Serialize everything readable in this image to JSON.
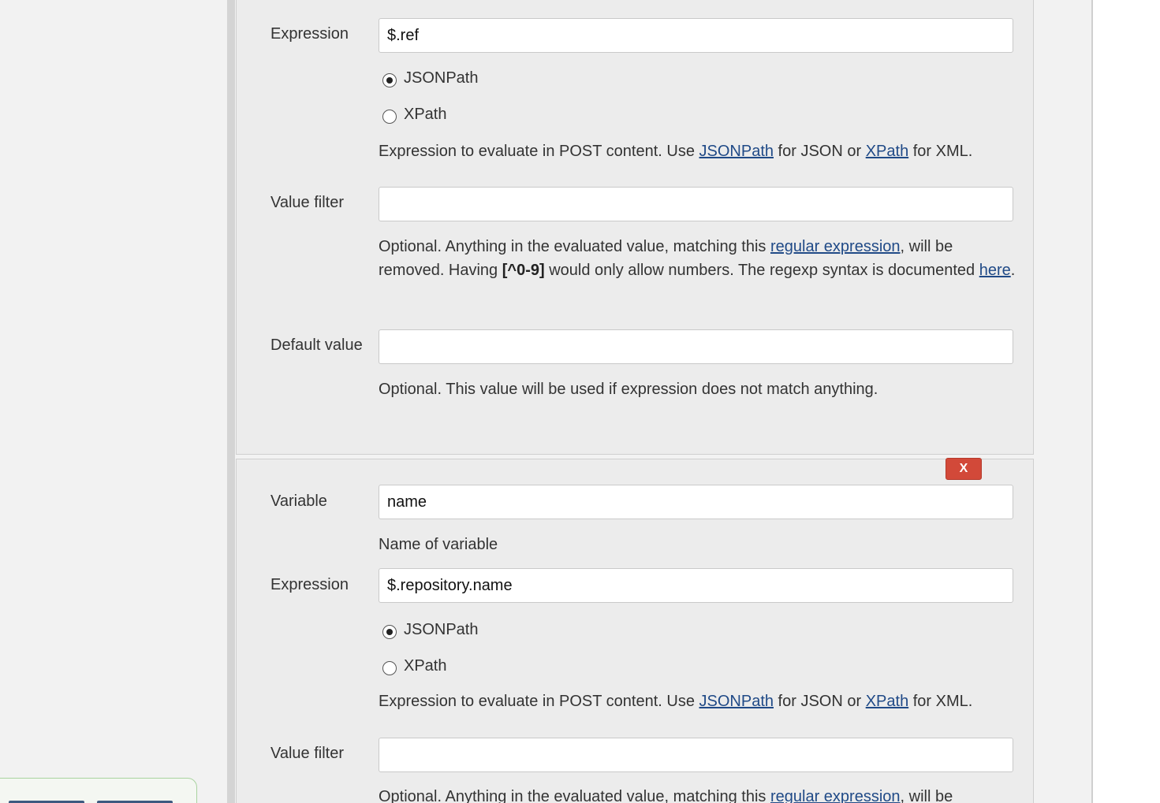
{
  "chunks": [
    {
      "expression": {
        "label": "Expression",
        "value": "$.ref",
        "options": [
          {
            "label": "JSONPath",
            "checked": true
          },
          {
            "label": "XPath",
            "checked": false
          }
        ],
        "help": {
          "prefix": "Expression to evaluate in POST content. Use ",
          "link_jsonpath": "JSONPath",
          "middle": " for JSON or ",
          "link_xpath": "XPath",
          "suffix": " for XML."
        }
      },
      "value_filter": {
        "label": "Value filter",
        "value": "",
        "help": {
          "prefix": "Optional. Anything in the evaluated value, matching this ",
          "link_regex": "regular expression",
          "middle": ", will be removed. Having ",
          "bold": "[^0-9]",
          "after_bold": " would only allow numbers. The regexp syntax is documented ",
          "link_here": "here",
          "end": "."
        }
      },
      "default_value": {
        "label": "Default value",
        "value": "",
        "help": "Optional. This value will be used if expression does not match anything."
      }
    },
    {
      "delete_label": "X",
      "variable": {
        "label": "Variable",
        "value": "name",
        "help": "Name of variable"
      },
      "expression": {
        "label": "Expression",
        "value": "$.repository.name",
        "options": [
          {
            "label": "JSONPath",
            "checked": true
          },
          {
            "label": "XPath",
            "checked": false
          }
        ],
        "help": {
          "prefix": "Expression to evaluate in POST content. Use ",
          "link_jsonpath": "JSONPath",
          "middle": " for JSON or ",
          "link_xpath": "XPath",
          "suffix": " for XML."
        }
      },
      "value_filter": {
        "label": "Value filter",
        "value": "",
        "help": {
          "prefix": "Optional. Anything in the evaluated value, matching this ",
          "link_regex": "regular expression",
          "middle": ", will be"
        }
      }
    }
  ]
}
